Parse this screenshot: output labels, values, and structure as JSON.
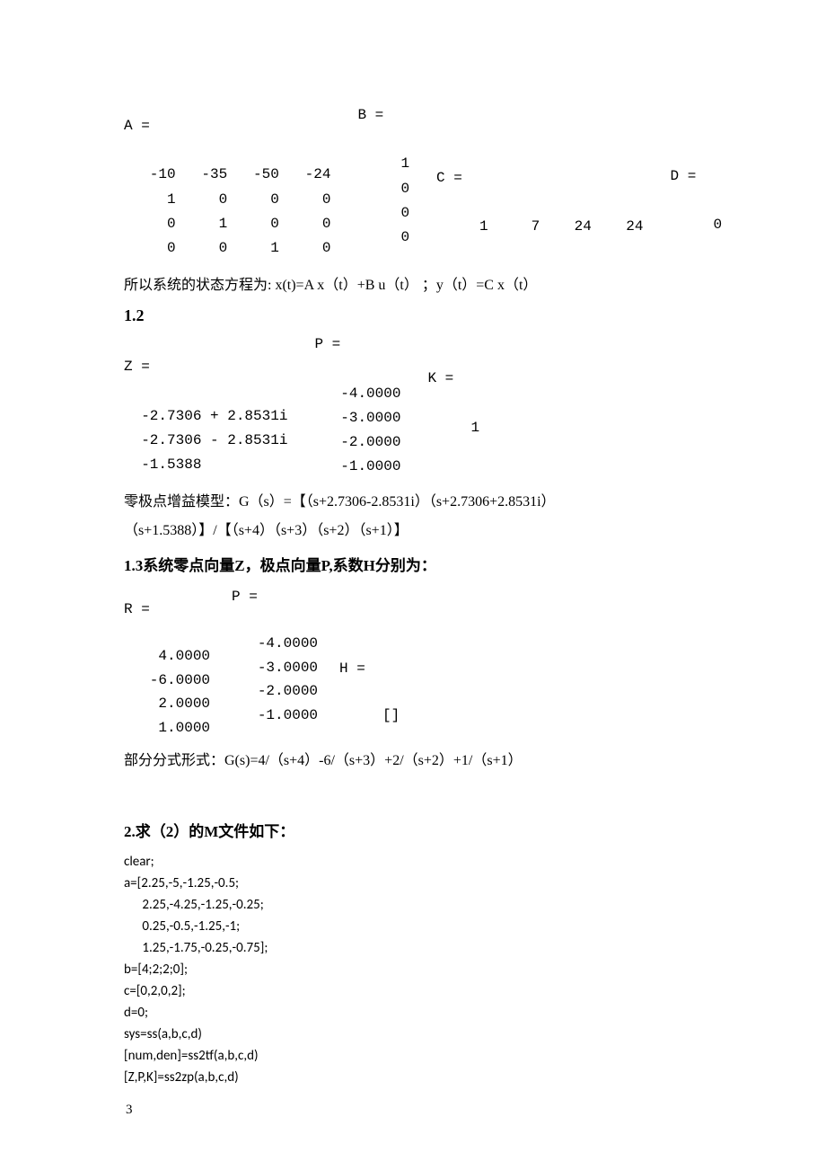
{
  "matrices1": {
    "A_label": "A =",
    "A_rows": "   -10   -35   -50   -24\n     1     0     0     0\n     0     1     0     0\n     0     0     1     0",
    "B_label": "B =",
    "B_rows": "     1\n     0\n     0\n     0",
    "C_label": "C =",
    "C_rows": "     1     7    24    24",
    "D_label": "D =",
    "D_rows": "     0"
  },
  "para_state_eq": "所以系统的状态方程为: x(t)=A x（t）+B u（t） ；y（t）=C x（t）",
  "heading_1_2": "1.2",
  "block2": {
    "Z_label": "Z =",
    "Z_rows": "  -2.7306 + 2.8531i\n  -2.7306 - 2.8531i\n  -1.5388",
    "P_label": "P =",
    "P_rows": "   -4.0000\n   -3.0000\n   -2.0000\n   -1.0000",
    "K_label": "K =",
    "K_rows": "     1"
  },
  "para_zpk1": "零极点增益模型：G（s）=【（s+2.7306-2.8531i）（s+2.7306+2.8531i）",
  "para_zpk2": "（s+1.5388）】/【（s+4）（s+3）（s+2）（s+1）】",
  "heading_1_3_num": "1.3",
  "heading_1_3_txt": "系统零点向量Z，极点向量P,系数H分别为：",
  "block3": {
    "R_label": "R =",
    "R_rows": "    4.0000\n   -6.0000\n    2.0000\n    1.0000",
    "P_label": "P =",
    "P_rows": "   -4.0000\n   -3.0000\n   -2.0000\n   -1.0000",
    "H_label": "H =",
    "H_rows": "     []"
  },
  "para_partial": "部分分式形式：G(s)=4/（s+4）-6/（s+3）+2/（s+2）+1/（s+1）",
  "heading_2_num": "2",
  "heading_2_txt": ".求（2）的M文件如下：",
  "code": "clear;\na=[2.25,-5,-1.25,-0.5;\n      2.25,-4.25,-1.25,-0.25;\n      0.25,-0.5,-1.25,-1;\n      1.25,-1.75,-0.25,-0.75];\nb=[4;2;2;0];\nc=[0,2,0,2];\nd=0;\nsys=ss(a,b,c,d)\n[num,den]=ss2tf(a,b,c,d)\n[Z,P,K]=ss2zp(a,b,c,d)",
  "page_number": "3"
}
